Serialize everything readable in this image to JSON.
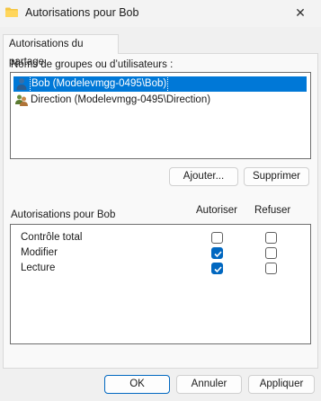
{
  "window": {
    "title": "Autorisations pour Bob",
    "close_glyph": "✕"
  },
  "tab": {
    "label": "Autorisations du partage"
  },
  "users_section": {
    "label": "Noms de groupes ou d’utilisateurs :",
    "items": [
      {
        "name": "Bob (Modelevmgg-0495\\Bob)",
        "icon": "user-icon",
        "selected": true
      },
      {
        "name": "Direction (Modelevmgg-0495\\Direction)",
        "icon": "group-icon",
        "selected": false
      }
    ],
    "add_label": "Ajouter...",
    "remove_label": "Supprimer"
  },
  "permissions_section": {
    "label": "Autorisations pour Bob",
    "col_allow": "Autoriser",
    "col_deny": "Refuser",
    "rows": [
      {
        "name": "Contrôle total",
        "allow": false,
        "deny": false
      },
      {
        "name": "Modifier",
        "allow": true,
        "deny": false
      },
      {
        "name": "Lecture",
        "allow": true,
        "deny": false
      }
    ]
  },
  "footer": {
    "ok_label": "OK",
    "cancel_label": "Annuler",
    "apply_label": "Appliquer"
  },
  "colors": {
    "accent": "#0067c0",
    "selection": "#0078d7"
  }
}
